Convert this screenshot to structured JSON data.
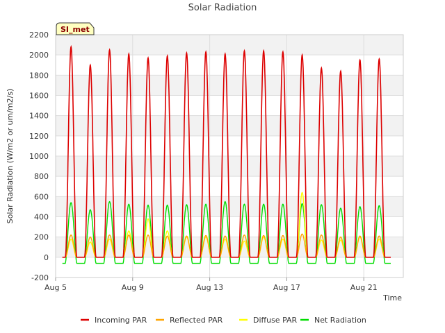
{
  "chart_data": {
    "type": "line",
    "title": "Solar Radiation",
    "xlabel": "Time",
    "ylabel": "Solar Radiation (W/m2 or um/m2/s)",
    "badge": "SI_met",
    "ylim": [
      -200,
      2200
    ],
    "yticks": [
      -200,
      0,
      200,
      400,
      600,
      800,
      1000,
      1200,
      1400,
      1600,
      1800,
      2000,
      2200
    ],
    "xlim_days": [
      5,
      23.05
    ],
    "xticks": [
      {
        "label": "Aug 5",
        "day": 5
      },
      {
        "label": "Aug 9",
        "day": 9
      },
      {
        "label": "Aug 13",
        "day": 13
      },
      {
        "label": "Aug 17",
        "day": 17
      },
      {
        "label": "Aug 21",
        "day": 21
      }
    ],
    "grid": true,
    "legend_position": "bottom",
    "colors": {
      "incoming": "#dd0000",
      "reflected": "#ffa500",
      "diffuse": "#ffff00",
      "net": "#00dd00",
      "band": "#f2f2f2",
      "grid": "#dddddd"
    },
    "days": [
      5.8,
      6.8,
      7.8,
      8.8,
      9.8,
      10.8,
      11.8,
      12.8,
      13.8,
      14.8,
      15.8,
      16.8,
      17.8,
      18.8,
      19.8,
      20.8,
      21.8
    ],
    "series": [
      {
        "name": "Incoming PAR",
        "key": "incoming",
        "peaks": [
          2080,
          1900,
          2050,
          2010,
          1970,
          1990,
          2020,
          2030,
          2010,
          2040,
          2040,
          2030,
          2000,
          1870,
          1840,
          1950,
          1960
        ],
        "night": 0
      },
      {
        "name": "Reflected PAR",
        "key": "reflected",
        "peaks": [
          220,
          200,
          220,
          220,
          220,
          210,
          210,
          215,
          210,
          220,
          215,
          215,
          230,
          220,
          200,
          210,
          210
        ],
        "night": 0
      },
      {
        "name": "Diffuse PAR",
        "key": "diffuse",
        "peaks": [
          180,
          150,
          180,
          260,
          380,
          260,
          200,
          200,
          180,
          160,
          200,
          180,
          640,
          170,
          170,
          200,
          180
        ],
        "night": 0
      },
      {
        "name": "Net Radiation",
        "key": "net",
        "peaks": [
          540,
          470,
          550,
          525,
          515,
          515,
          520,
          525,
          550,
          525,
          525,
          525,
          530,
          520,
          485,
          500,
          510
        ],
        "night": -60
      }
    ]
  }
}
